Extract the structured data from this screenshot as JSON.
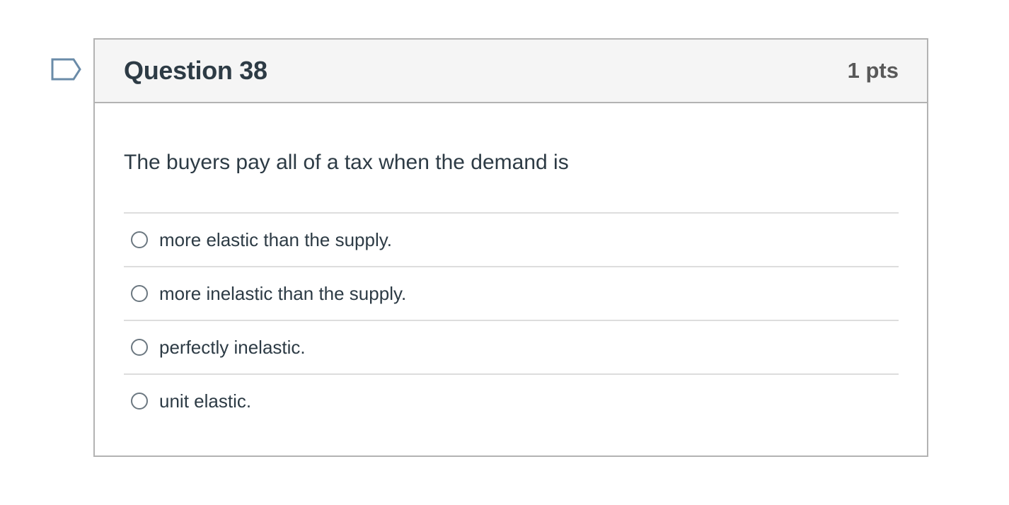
{
  "question": {
    "title": "Question 38",
    "points": "1 pts",
    "text": "The buyers pay all of a tax when the demand is",
    "answers": [
      {
        "label": "more elastic than the supply."
      },
      {
        "label": "more inelastic than the supply."
      },
      {
        "label": "perfectly inelastic."
      },
      {
        "label": "unit elastic."
      }
    ]
  },
  "flag": {
    "icon": "flag-question-icon"
  },
  "colors": {
    "header_bg": "#f5f5f5",
    "border": "#b3b3b3",
    "text": "#2d3b45",
    "flag_stroke": "#6a8ba8"
  }
}
